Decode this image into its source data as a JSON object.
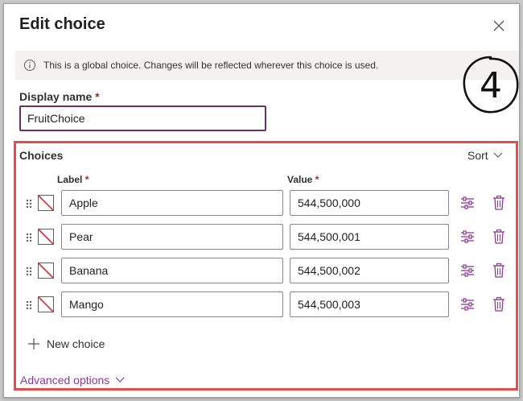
{
  "dialog": {
    "title": "Edit choice",
    "info_text": "This is a global choice. Changes will be reflected wherever this choice is used."
  },
  "annotation": {
    "number": "4"
  },
  "display_name": {
    "label": "Display name",
    "required_marker": "*",
    "value": "FruitChoice"
  },
  "choices": {
    "heading": "Choices",
    "sort_label": "Sort",
    "label_header": "Label",
    "value_header": "Value",
    "required_marker": "*",
    "items": [
      {
        "label": "Apple",
        "value": "544,500,000"
      },
      {
        "label": "Pear",
        "value": "544,500,001"
      },
      {
        "label": "Banana",
        "value": "544,500,002"
      },
      {
        "label": "Mango",
        "value": "544,500,003"
      }
    ],
    "new_choice_label": "New choice"
  },
  "advanced_options_label": "Advanced options",
  "colors": {
    "accent_purple": "#6b2f6b",
    "link_purple": "#8a3b93",
    "highlight_red": "#e74c4c",
    "required_red": "#a4262c"
  },
  "icons": {
    "close": "close-icon",
    "info": "info-icon",
    "sort_chevron": "chevron-down-icon",
    "drag": "drag-handle-icon",
    "color_swatch": "no-color-swatch-icon",
    "options": "options-sliders-icon",
    "delete": "trash-icon",
    "add": "plus-icon"
  }
}
